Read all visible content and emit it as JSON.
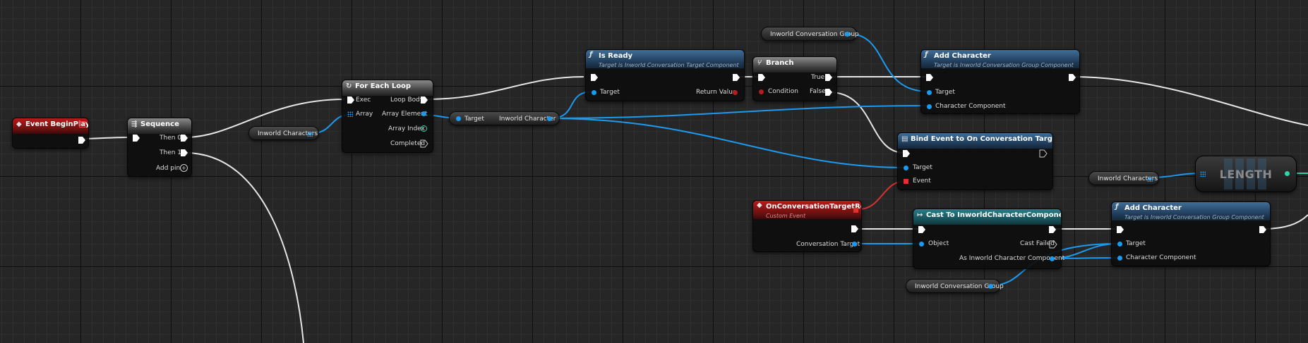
{
  "colors": {
    "exec_pin": "#ffffff",
    "object_pin": "#1b9bf0",
    "bool_pin": "#b01e1e",
    "struct_pin": "#30d4a8",
    "event_delegate_pin": "#e03030",
    "array_pin": "#1b9bf0"
  },
  "nodes": {
    "event_begin_play": {
      "title": "Event BeginPlay",
      "icon": "event-icon"
    },
    "sequence": {
      "title": "Sequence",
      "then0": "Then 0",
      "then1": "Then 1",
      "add_pin": "Add pin"
    },
    "var_inworld_characters_1": {
      "label": "Inworld Characters"
    },
    "for_each_loop": {
      "title": "For Each Loop",
      "exec": "Exec",
      "array": "Array",
      "loop_body": "Loop Body",
      "array_element": "Array Element",
      "array_index": "Array Index",
      "completed": "Completed"
    },
    "cast_inline": {
      "target": "Target",
      "output": "Inworld Character"
    },
    "is_ready": {
      "title": "Is Ready",
      "subtitle": "Target is Inworld Conversation Target Component",
      "target": "Target",
      "return_value": "Return Value"
    },
    "branch": {
      "title": "Branch",
      "condition": "Condition",
      "true_label": "True",
      "false_label": "False"
    },
    "var_conversation_group_top": {
      "label": "Inworld Conversation Group"
    },
    "add_character_top": {
      "title": "Add Character",
      "subtitle": "Target is Inworld Conversation Group Component",
      "target": "Target",
      "character_component": "Character Component"
    },
    "bind_event": {
      "title": "Bind Event to On Conversation Target Ready",
      "target": "Target",
      "event": "Event"
    },
    "custom_event": {
      "title": "OnConversationTargetReady",
      "subtitle": "Custom Event",
      "conversation_target": "Conversation Target"
    },
    "cast_to": {
      "title": "Cast To InworldCharacterComponent",
      "object": "Object",
      "cast_failed": "Cast Failed",
      "as_component": "As Inworld Character Component"
    },
    "var_conversation_group_bottom": {
      "label": "Inworld Conversation Group"
    },
    "add_character_bottom": {
      "title": "Add Character",
      "subtitle": "Target is Inworld Conversation Group Component",
      "target": "Target",
      "character_component": "Character Component"
    },
    "var_inworld_characters_2": {
      "label": "Inworld Characters"
    },
    "length": {
      "label": "LENGTH"
    }
  }
}
